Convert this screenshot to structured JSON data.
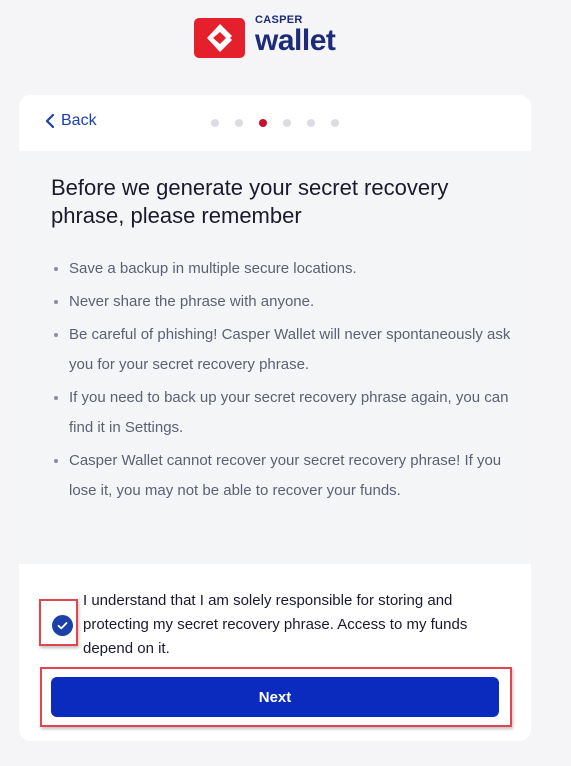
{
  "brand": {
    "top": "CASPER",
    "bottom": "wallet",
    "icon": "casper-logo-icon",
    "color": "#1c2b7a",
    "mark_color": "#e4202c"
  },
  "header": {
    "back_label": "Back",
    "back_icon": "chevron-left-icon",
    "steps_total": 6,
    "current_step": 3
  },
  "main": {
    "title": "Before we generate your secret recovery phrase, please remember",
    "bullets": [
      "Save a backup in multiple secure locations.",
      "Never share the phrase with anyone.",
      "Be careful of phishing! Casper Wallet will never spontaneously ask you for your secret recovery phrase.",
      "If you need to back up your secret recovery phrase again, you can find it in Settings.",
      "Casper Wallet cannot recover your secret recovery phrase! If you lose it, you may not be able to recover your funds."
    ]
  },
  "footer": {
    "consent_checked": true,
    "consent_text": "I understand that I am solely responsible for storing and protecting my secret recovery phrase. Access to my funds depend on it.",
    "next_label": "Next",
    "accent": "#0a2bbe",
    "highlight_color": "#e0464f"
  }
}
